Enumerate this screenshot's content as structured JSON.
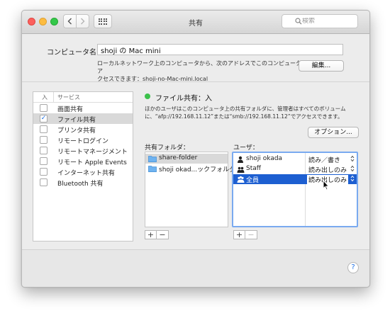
{
  "window": {
    "title": "共有"
  },
  "toolbar": {
    "back_label": "‹",
    "forward_label": "›"
  },
  "search": {
    "placeholder": "検索",
    "value": ""
  },
  "computer_name": {
    "label": "コンピュータ名：",
    "value": "shoji の Mac mini",
    "description_line1": "ローカルネットワーク上のコンピュータから、次のアドレスでこのコンピュータにア",
    "description_line2": "クセスできます：shoji-no-Mac-mini.local",
    "edit_button": "編集..."
  },
  "services": {
    "col_on": "入",
    "col_service": "サービス",
    "items": [
      {
        "label": "画面共有",
        "checked": false,
        "selected": false
      },
      {
        "label": "ファイル共有",
        "checked": true,
        "selected": true
      },
      {
        "label": "プリンタ共有",
        "checked": false,
        "selected": false
      },
      {
        "label": "リモートログイン",
        "checked": false,
        "selected": false
      },
      {
        "label": "リモートマネージメント",
        "checked": false,
        "selected": false
      },
      {
        "label": "リモート Apple Events",
        "checked": false,
        "selected": false
      },
      {
        "label": "インターネット共有",
        "checked": false,
        "selected": false
      },
      {
        "label": "Bluetooth 共有",
        "checked": false,
        "selected": false
      }
    ]
  },
  "status": {
    "text": "ファイル共有：入",
    "color": "#3cc14b",
    "info_line1": "ほかのユーザはこのコンピュータ上の共有フォルダに、管理者はすべてのボリューム",
    "info_line2": "に、“afp://192.168.11.12”または“smb://192.168.11.12”でアクセスできます。"
  },
  "options_button": "オプション...",
  "shared_folders": {
    "label": "共有フォルダ：",
    "items": [
      {
        "name": "share-folder",
        "selected": true
      },
      {
        "name": "shoji okad...ックフォルダ",
        "selected": false
      }
    ]
  },
  "users": {
    "label": "ユーザ：",
    "items": [
      {
        "name": "shoji okada",
        "permission": "読み／書き",
        "icon": "single-user-icon",
        "selected": false
      },
      {
        "name": "Staff",
        "permission": "読み出しのみ",
        "icon": "group-icon",
        "selected": false
      },
      {
        "name": "全員",
        "permission": "読み出しのみ",
        "icon": "everyone-icon",
        "selected": true
      }
    ]
  },
  "controls": {
    "add": "+",
    "remove": "−",
    "updown": "⌃⌄"
  },
  "help": {
    "label": "?"
  },
  "colors": {
    "accent": "#1d5fd1",
    "focus_ring": "#7aaaf0"
  }
}
